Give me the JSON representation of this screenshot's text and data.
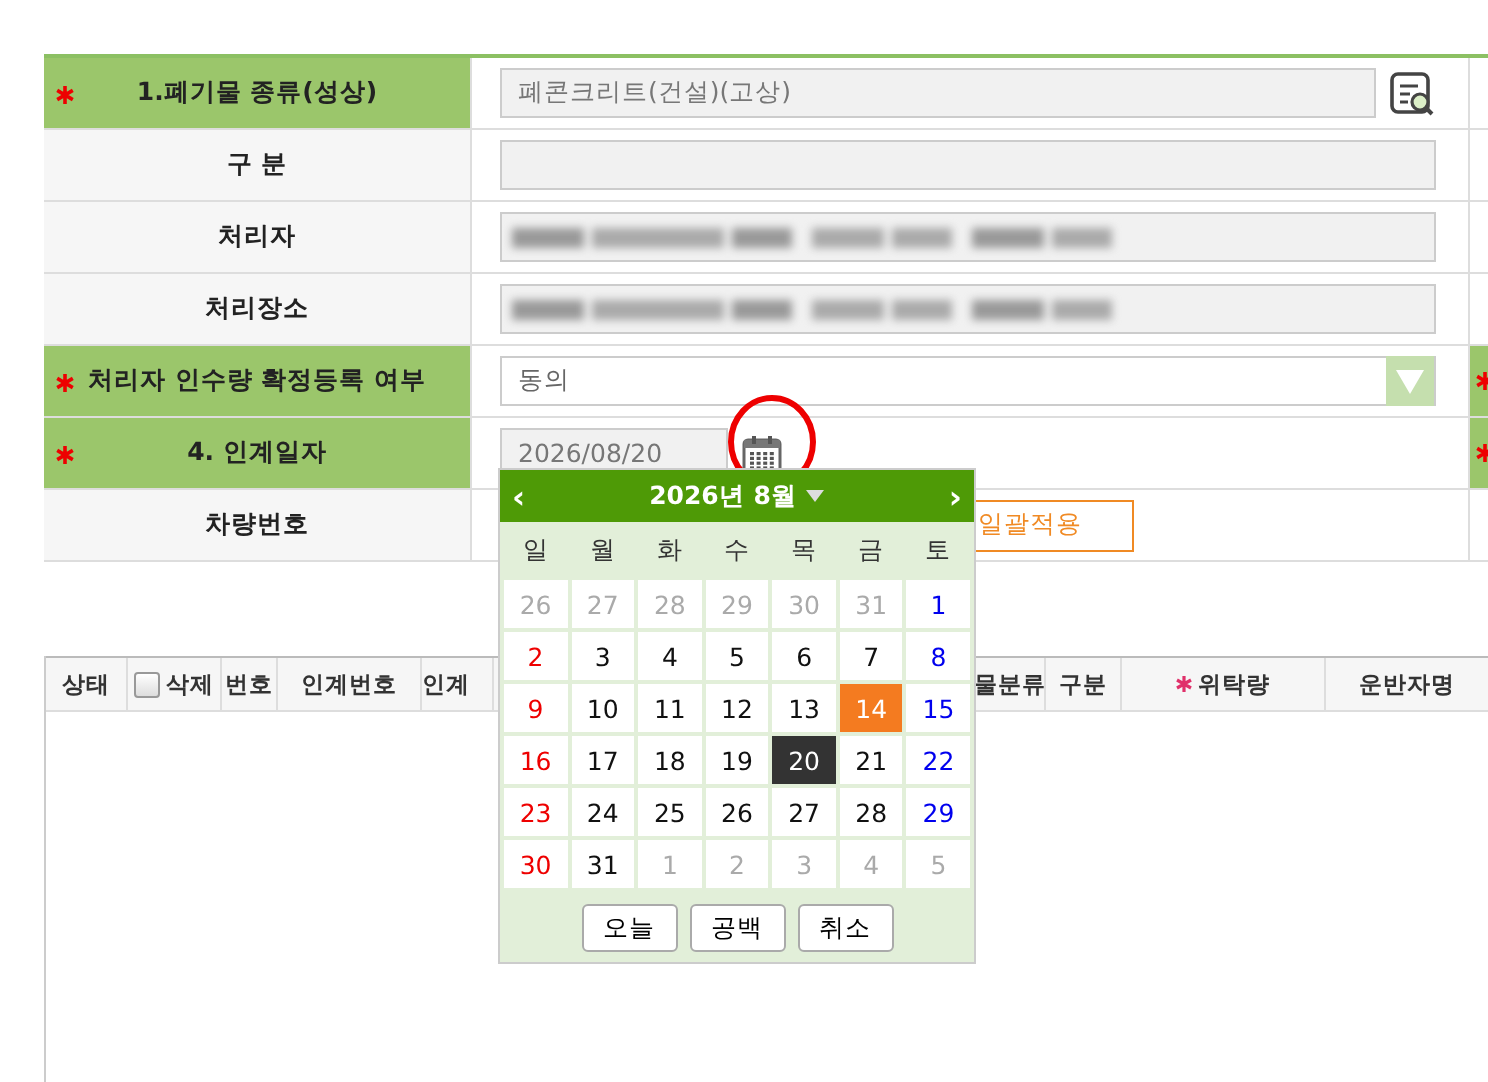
{
  "form": {
    "rows": [
      {
        "label": "1.폐기물 종류(성상)",
        "required": true,
        "kind": "search",
        "value": "폐콘크리트(건설)(고상)",
        "edge_required": false
      },
      {
        "label": "구 분",
        "required": false,
        "kind": "text",
        "value": "",
        "edge_required": false
      },
      {
        "label": "처리자",
        "required": false,
        "kind": "redacted",
        "edge_required": false
      },
      {
        "label": "처리장소",
        "required": false,
        "kind": "redacted",
        "edge_required": false
      },
      {
        "label": "처리자 인수량 확정등록 여부",
        "required": true,
        "kind": "select",
        "value": "동의",
        "edge_required": true
      },
      {
        "label": "4. 인계일자",
        "required": true,
        "kind": "date",
        "value": "2026/08/20",
        "edge_required": true
      },
      {
        "label": "차량번호",
        "required": false,
        "kind": "vehicle",
        "button": "일괄적용",
        "edge_required": false
      }
    ]
  },
  "table": {
    "columns": [
      {
        "label": "상태",
        "kind": "plain",
        "required": false
      },
      {
        "label": "삭제",
        "kind": "checkbox",
        "required": false,
        "checked": false
      },
      {
        "label": "번호",
        "kind": "plain",
        "required": false
      },
      {
        "label": "인계번호",
        "kind": "plain",
        "required": false
      },
      {
        "label": "인계",
        "kind": "cut",
        "required": false
      },
      {
        "label": "물분류",
        "kind": "cut",
        "required": false
      },
      {
        "label": "구분",
        "kind": "plain",
        "required": false
      },
      {
        "label": "위탁량",
        "kind": "plain",
        "required": true
      },
      {
        "label": "운반자명",
        "kind": "plain",
        "required": false
      }
    ]
  },
  "calendar": {
    "title": "2026년 8월",
    "prev": "‹",
    "next": "›",
    "weekdays": [
      "일",
      "월",
      "화",
      "수",
      "목",
      "금",
      "토"
    ],
    "weeks": [
      [
        {
          "day": "26",
          "muted": true,
          "today": false,
          "selected": false
        },
        {
          "day": "27",
          "muted": true,
          "today": false,
          "selected": false
        },
        {
          "day": "28",
          "muted": true,
          "today": false,
          "selected": false
        },
        {
          "day": "29",
          "muted": true,
          "today": false,
          "selected": false
        },
        {
          "day": "30",
          "muted": true,
          "today": false,
          "selected": false
        },
        {
          "day": "31",
          "muted": true,
          "today": false,
          "selected": false
        },
        {
          "day": "1",
          "muted": false,
          "today": false,
          "selected": false
        }
      ],
      [
        {
          "day": "2",
          "muted": false,
          "today": false,
          "selected": false
        },
        {
          "day": "3",
          "muted": false,
          "today": false,
          "selected": false
        },
        {
          "day": "4",
          "muted": false,
          "today": false,
          "selected": false
        },
        {
          "day": "5",
          "muted": false,
          "today": false,
          "selected": false
        },
        {
          "day": "6",
          "muted": false,
          "today": false,
          "selected": false
        },
        {
          "day": "7",
          "muted": false,
          "today": false,
          "selected": false
        },
        {
          "day": "8",
          "muted": false,
          "today": false,
          "selected": false
        }
      ],
      [
        {
          "day": "9",
          "muted": false,
          "today": false,
          "selected": false
        },
        {
          "day": "10",
          "muted": false,
          "today": false,
          "selected": false
        },
        {
          "day": "11",
          "muted": false,
          "today": false,
          "selected": false
        },
        {
          "day": "12",
          "muted": false,
          "today": false,
          "selected": false
        },
        {
          "day": "13",
          "muted": false,
          "today": false,
          "selected": false
        },
        {
          "day": "14",
          "muted": false,
          "today": true,
          "selected": false
        },
        {
          "day": "15",
          "muted": false,
          "today": false,
          "selected": false
        }
      ],
      [
        {
          "day": "16",
          "muted": false,
          "today": false,
          "selected": false
        },
        {
          "day": "17",
          "muted": false,
          "today": false,
          "selected": false
        },
        {
          "day": "18",
          "muted": false,
          "today": false,
          "selected": false
        },
        {
          "day": "19",
          "muted": false,
          "today": false,
          "selected": false
        },
        {
          "day": "20",
          "muted": false,
          "today": false,
          "selected": true
        },
        {
          "day": "21",
          "muted": false,
          "today": false,
          "selected": false
        },
        {
          "day": "22",
          "muted": false,
          "today": false,
          "selected": false
        }
      ],
      [
        {
          "day": "23",
          "muted": false,
          "today": false,
          "selected": false
        },
        {
          "day": "24",
          "muted": false,
          "today": false,
          "selected": false
        },
        {
          "day": "25",
          "muted": false,
          "today": false,
          "selected": false
        },
        {
          "day": "26",
          "muted": false,
          "today": false,
          "selected": false
        },
        {
          "day": "27",
          "muted": false,
          "today": false,
          "selected": false
        },
        {
          "day": "28",
          "muted": false,
          "today": false,
          "selected": false
        },
        {
          "day": "29",
          "muted": false,
          "today": false,
          "selected": false
        }
      ],
      [
        {
          "day": "30",
          "muted": false,
          "today": false,
          "selected": false
        },
        {
          "day": "31",
          "muted": false,
          "today": false,
          "selected": false
        },
        {
          "day": "1",
          "muted": true,
          "today": false,
          "selected": false
        },
        {
          "day": "2",
          "muted": true,
          "today": false,
          "selected": false
        },
        {
          "day": "3",
          "muted": true,
          "today": false,
          "selected": false
        },
        {
          "day": "4",
          "muted": true,
          "today": false,
          "selected": false
        },
        {
          "day": "5",
          "muted": true,
          "today": false,
          "selected": false
        }
      ]
    ],
    "buttons": [
      "오늘",
      "공백",
      "취소"
    ]
  }
}
